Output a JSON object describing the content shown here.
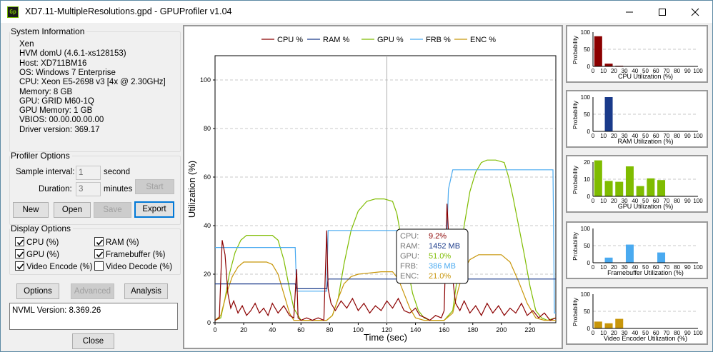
{
  "window": {
    "title": "XD7.11-MultipleResolutions.gpd - GPUProfiler v1.04",
    "icon_text": "Gp",
    "minimize_icon": "minimize-icon",
    "maximize_icon": "maximize-icon",
    "close_icon": "close-icon"
  },
  "system_info": {
    "legend": "System Information",
    "lines": [
      "Xen",
      "HVM domU (4.6.1-xs128153)",
      "Host: XD711BM16",
      "OS: Windows 7 Enterprise",
      "CPU: Xeon E5-2698 v3 [4x @ 2.30GHz]",
      "Memory: 8 GB",
      "GPU: GRID M60-1Q",
      "GPU Memory: 1 GB",
      "VBIOS: 00.00.00.00.00",
      "Driver version: 369.17"
    ]
  },
  "profiler": {
    "legend": "Profiler Options",
    "sample_label": "Sample interval:",
    "sample_value": "1",
    "sample_unit": "second",
    "duration_label": "Duration:",
    "duration_value": "3",
    "duration_unit": "minutes",
    "start": "Start"
  },
  "file_buttons": {
    "new": "New",
    "open": "Open",
    "save": "Save",
    "export": "Export"
  },
  "display": {
    "legend": "Display Options",
    "items": [
      {
        "label": "CPU (%)",
        "checked": true
      },
      {
        "label": "RAM (%)",
        "checked": true
      },
      {
        "label": "GPU (%)",
        "checked": true
      },
      {
        "label": "Framebuffer (%)",
        "checked": true
      },
      {
        "label": "Video Encode (%)",
        "checked": true
      },
      {
        "label": "Video Decode (%)",
        "checked": false
      }
    ]
  },
  "bottom_buttons": {
    "options": "Options",
    "advanced": "Advanced",
    "analysis": "Analysis",
    "close": "Close"
  },
  "nvml": "NVML Version: 8.369.26",
  "colors": {
    "cpu": "#8b0000",
    "ram": "#1a3a8a",
    "gpu": "#7fbc00",
    "frb": "#4aaaf0",
    "enc": "#c8960a",
    "cursor": "#b0b0b0"
  },
  "chart_data": [
    {
      "type": "line",
      "xlabel": "Time (sec)",
      "ylabel": "Utilization (%)",
      "xlim": [
        0,
        238
      ],
      "ylim": [
        0,
        110
      ],
      "xticks": [
        0,
        20,
        40,
        60,
        80,
        100,
        120,
        140,
        160,
        180,
        200,
        220
      ],
      "yticks": [
        0,
        20,
        40,
        60,
        80,
        100
      ],
      "grid": true,
      "legend_position": "top",
      "cursor_x": 120,
      "series": [
        {
          "name": "CPU %",
          "color_key": "cpu",
          "points": [
            [
              0,
              1
            ],
            [
              3,
              2
            ],
            [
              5,
              34
            ],
            [
              7,
              28
            ],
            [
              9,
              12
            ],
            [
              11,
              6
            ],
            [
              13,
              9
            ],
            [
              16,
              4
            ],
            [
              19,
              7
            ],
            [
              22,
              3
            ],
            [
              25,
              5
            ],
            [
              28,
              8
            ],
            [
              31,
              4
            ],
            [
              34,
              6
            ],
            [
              37,
              3
            ],
            [
              40,
              8
            ],
            [
              44,
              4
            ],
            [
              48,
              7
            ],
            [
              52,
              3
            ],
            [
              55,
              2
            ],
            [
              57,
              22
            ],
            [
              58,
              2
            ],
            [
              60,
              1
            ],
            [
              64,
              2
            ],
            [
              68,
              1
            ],
            [
              72,
              2
            ],
            [
              76,
              1
            ],
            [
              78,
              38
            ],
            [
              79,
              14
            ],
            [
              81,
              8
            ],
            [
              84,
              5
            ],
            [
              88,
              9
            ],
            [
              92,
              6
            ],
            [
              96,
              10
            ],
            [
              100,
              5
            ],
            [
              104,
              8
            ],
            [
              108,
              4
            ],
            [
              112,
              7
            ],
            [
              116,
              5
            ],
            [
              120,
              9
            ],
            [
              124,
              6
            ],
            [
              128,
              10
            ],
            [
              132,
              5
            ],
            [
              136,
              4
            ],
            [
              140,
              6
            ],
            [
              143,
              3
            ],
            [
              147,
              2
            ],
            [
              150,
              1
            ],
            [
              154,
              3
            ],
            [
              158,
              2
            ],
            [
              160,
              5
            ],
            [
              162,
              49
            ],
            [
              164,
              26
            ],
            [
              166,
              18
            ],
            [
              168,
              8
            ],
            [
              171,
              5
            ],
            [
              174,
              9
            ],
            [
              178,
              4
            ],
            [
              182,
              7
            ],
            [
              186,
              3
            ],
            [
              190,
              8
            ],
            [
              194,
              4
            ],
            [
              198,
              7
            ],
            [
              202,
              3
            ],
            [
              206,
              6
            ],
            [
              210,
              4
            ],
            [
              214,
              8
            ],
            [
              218,
              3
            ],
            [
              222,
              5
            ],
            [
              226,
              2
            ],
            [
              230,
              4
            ],
            [
              234,
              1
            ],
            [
              238,
              2
            ]
          ]
        },
        {
          "name": "RAM %",
          "color_key": "ram",
          "points": [
            [
              0,
              16
            ],
            [
              56,
              16
            ],
            [
              57,
              14
            ],
            [
              78,
              14
            ],
            [
              79,
              18
            ],
            [
              238,
              18
            ]
          ]
        },
        {
          "name": "GPU %",
          "color_key": "gpu",
          "points": [
            [
              0,
              1
            ],
            [
              4,
              2
            ],
            [
              7,
              10
            ],
            [
              10,
              20
            ],
            [
              14,
              29
            ],
            [
              18,
              34
            ],
            [
              22,
              36
            ],
            [
              30,
              36
            ],
            [
              40,
              36
            ],
            [
              44,
              34
            ],
            [
              48,
              26
            ],
            [
              52,
              14
            ],
            [
              55,
              6
            ],
            [
              57,
              4
            ],
            [
              60,
              1
            ],
            [
              78,
              1
            ],
            [
              82,
              3
            ],
            [
              86,
              10
            ],
            [
              90,
              24
            ],
            [
              95,
              38
            ],
            [
              100,
              46
            ],
            [
              106,
              50
            ],
            [
              112,
              51
            ],
            [
              118,
              51
            ],
            [
              124,
              50
            ],
            [
              127,
              45
            ],
            [
              130,
              35
            ],
            [
              134,
              24
            ],
            [
              138,
              12
            ],
            [
              142,
              5
            ],
            [
              146,
              2
            ],
            [
              150,
              1
            ],
            [
              160,
              1
            ],
            [
              166,
              5
            ],
            [
              170,
              22
            ],
            [
              174,
              40
            ],
            [
              178,
              54
            ],
            [
              182,
              62
            ],
            [
              186,
              66
            ],
            [
              190,
              67
            ],
            [
              196,
              67
            ],
            [
              202,
              66
            ],
            [
              205,
              60
            ],
            [
              208,
              52
            ],
            [
              212,
              40
            ],
            [
              216,
              28
            ],
            [
              220,
              15
            ],
            [
              224,
              5
            ],
            [
              228,
              2
            ],
            [
              232,
              1
            ],
            [
              238,
              2
            ]
          ]
        },
        {
          "name": "FRB %",
          "color_key": "frb",
          "points": [
            [
              0,
              31
            ],
            [
              56,
              31
            ],
            [
              57,
              13
            ],
            [
              78,
              13
            ],
            [
              79,
              38
            ],
            [
              162,
              38
            ],
            [
              163,
              55
            ],
            [
              166,
              63
            ],
            [
              236,
              63
            ],
            [
              237,
              4
            ],
            [
              238,
              4
            ]
          ]
        },
        {
          "name": "ENC %",
          "color_key": "enc",
          "points": [
            [
              0,
              1
            ],
            [
              4,
              3
            ],
            [
              8,
              12
            ],
            [
              12,
              19
            ],
            [
              16,
              23
            ],
            [
              20,
              25
            ],
            [
              36,
              25
            ],
            [
              40,
              24
            ],
            [
              44,
              20
            ],
            [
              48,
              12
            ],
            [
              52,
              4
            ],
            [
              55,
              1
            ],
            [
              78,
              1
            ],
            [
              82,
              3
            ],
            [
              86,
              10
            ],
            [
              90,
              16
            ],
            [
              95,
              19
            ],
            [
              100,
              20
            ],
            [
              116,
              21
            ],
            [
              124,
              21
            ],
            [
              128,
              18
            ],
            [
              132,
              12
            ],
            [
              136,
              6
            ],
            [
              140,
              2
            ],
            [
              146,
              1
            ],
            [
              160,
              1
            ],
            [
              166,
              4
            ],
            [
              170,
              14
            ],
            [
              174,
              22
            ],
            [
              178,
              26
            ],
            [
              184,
              28
            ],
            [
              200,
              28
            ],
            [
              206,
              25
            ],
            [
              212,
              17
            ],
            [
              218,
              8
            ],
            [
              224,
              2
            ],
            [
              230,
              1
            ],
            [
              238,
              1
            ]
          ]
        }
      ],
      "tooltip": [
        {
          "label": "CPU:",
          "value": "9.2%",
          "color_key": "cpu"
        },
        {
          "label": "RAM:",
          "value": "1452 MB",
          "color_key": "ram"
        },
        {
          "label": "GPU:",
          "value": "51.0%",
          "color_key": "gpu"
        },
        {
          "label": "FRB:",
          "value": "386 MB",
          "color_key": "frb"
        },
        {
          "label": "ENC:",
          "value": "21.0%",
          "color_key": "enc"
        }
      ]
    },
    {
      "type": "bar",
      "xlabel": "CPU Utilization (%)",
      "ylabel": "Probability",
      "color_key": "cpu",
      "categories": [
        0,
        10,
        20,
        30,
        40,
        50,
        60,
        70,
        80,
        90,
        100
      ],
      "ylim": [
        0,
        100
      ],
      "yticks": [
        0,
        50,
        100
      ],
      "bars": [
        [
          5,
          88
        ],
        [
          15,
          8
        ],
        [
          25,
          2
        ]
      ]
    },
    {
      "type": "bar",
      "xlabel": "RAM Utilization (%)",
      "ylabel": "Probability",
      "color_key": "ram",
      "categories": [
        0,
        10,
        20,
        30,
        40,
        50,
        60,
        70,
        80,
        90,
        100
      ],
      "ylim": [
        0,
        100
      ],
      "yticks": [
        0,
        50,
        100
      ],
      "bars": [
        [
          15,
          100
        ]
      ]
    },
    {
      "type": "bar",
      "xlabel": "GPU Utilization (%)",
      "ylabel": "Probability",
      "color_key": "gpu",
      "categories": [
        0,
        10,
        20,
        30,
        40,
        50,
        60,
        70,
        80,
        90,
        100
      ],
      "ylim": [
        0,
        20
      ],
      "yticks": [
        0,
        10,
        20
      ],
      "bars": [
        [
          5,
          21
        ],
        [
          15,
          9
        ],
        [
          25,
          8.5
        ],
        [
          35,
          17.5
        ],
        [
          45,
          6
        ],
        [
          55,
          10.5
        ],
        [
          65,
          9.5
        ]
      ]
    },
    {
      "type": "bar",
      "xlabel": "Framebuffer Utilization (%)",
      "ylabel": "Probability",
      "color_key": "frb",
      "categories": [
        0,
        10,
        20,
        30,
        40,
        50,
        60,
        70,
        80,
        90,
        100
      ],
      "ylim": [
        0,
        100
      ],
      "yticks": [
        0,
        50,
        100
      ],
      "bars": [
        [
          15,
          15
        ],
        [
          35,
          53
        ],
        [
          65,
          30
        ]
      ]
    },
    {
      "type": "bar",
      "xlabel": "Video Encoder Utilization (%)",
      "ylabel": "Probability",
      "color_key": "enc",
      "categories": [
        0,
        10,
        20,
        30,
        40,
        50,
        60,
        70,
        80,
        90,
        100
      ],
      "ylim": [
        0,
        100
      ],
      "yticks": [
        0,
        50,
        100
      ],
      "bars": [
        [
          5,
          20
        ],
        [
          15,
          15
        ],
        [
          25,
          28
        ]
      ]
    }
  ]
}
